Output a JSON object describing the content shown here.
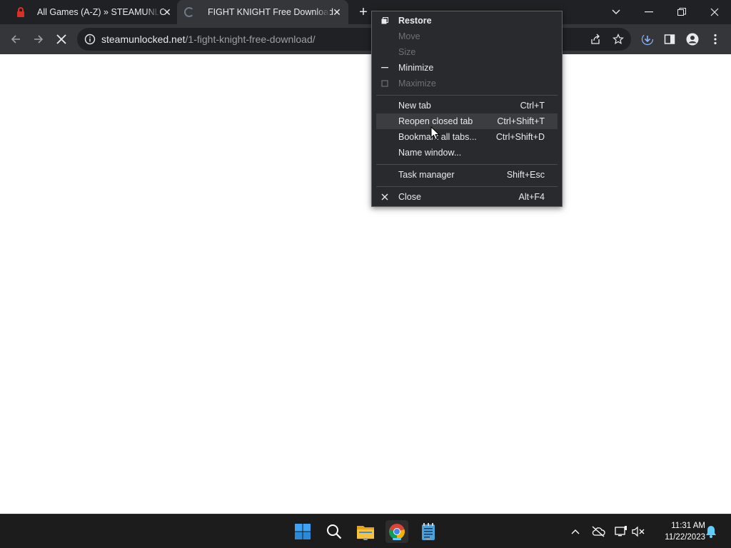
{
  "browser": {
    "tabs": [
      {
        "title": "All Games (A-Z) » STEAMUNLOCKED",
        "active": false
      },
      {
        "title": "FIGHT KNIGHT Free Download (v",
        "active": true
      }
    ],
    "address": {
      "domain": "steamunlocked.net",
      "path": "/1-fight-knight-free-download/"
    }
  },
  "context_menu": {
    "items": [
      {
        "label": "Restore",
        "icon": "restore-icon",
        "enabled": true
      },
      {
        "label": "Move",
        "enabled": false
      },
      {
        "label": "Size",
        "enabled": false
      },
      {
        "label": "Minimize",
        "icon": "minimize-icon",
        "enabled": true
      },
      {
        "label": "Maximize",
        "icon": "maximize-icon",
        "enabled": false
      },
      {
        "label": "New tab",
        "shortcut": "Ctrl+T"
      },
      {
        "label": "Reopen closed tab",
        "shortcut": "Ctrl+Shift+T",
        "hovered": true
      },
      {
        "label": "Bookmark all tabs...",
        "shortcut": "Ctrl+Shift+D"
      },
      {
        "label": "Name window..."
      },
      {
        "label": "Task manager",
        "shortcut": "Shift+Esc"
      },
      {
        "label": "Close",
        "icon": "close-icon",
        "shortcut": "Alt+F4"
      }
    ]
  },
  "taskbar": {
    "time": "11:31 AM",
    "date": "11/22/2023"
  },
  "colors": {
    "tab_strip": "#202124",
    "toolbar": "#35363a",
    "menu_bg": "#292a2d",
    "taskbar": "#1c1c1c",
    "accent": "#60cdff"
  }
}
